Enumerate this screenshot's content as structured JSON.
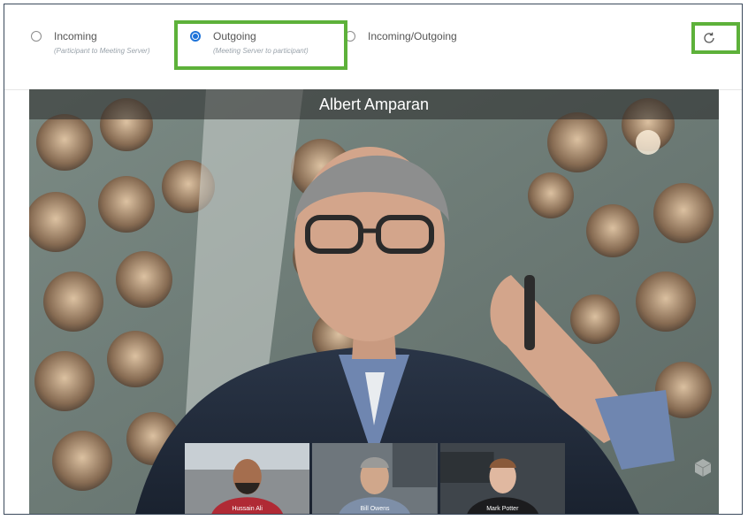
{
  "options": [
    {
      "label": "Incoming",
      "sub": "(Participant to Meeting Server)",
      "checked": false
    },
    {
      "label": "Outgoing",
      "sub": "(Meeting Server to participant)",
      "checked": true
    },
    {
      "label": "Incoming/Outgoing",
      "sub": "",
      "checked": false
    }
  ],
  "refresh_icon": "refresh-icon",
  "highlight_color": "#5db13a",
  "accent_color": "#1e73d8",
  "video": {
    "main_speaker": "Albert Amparan",
    "thumbnails": [
      {
        "name": "Hussain Ali"
      },
      {
        "name": "Bill Owens"
      },
      {
        "name": "Mark Potter"
      }
    ]
  }
}
